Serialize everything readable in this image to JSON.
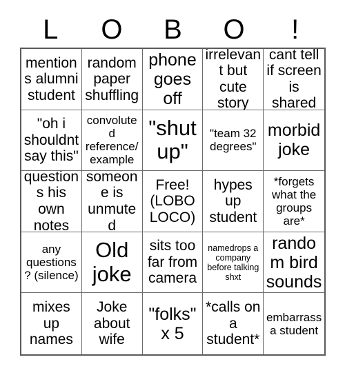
{
  "header": {
    "letters": [
      "L",
      "O",
      "B",
      "O",
      "!"
    ]
  },
  "grid": {
    "columns": 5,
    "rows": 5,
    "cells": [
      {
        "text": "mentions alumni student",
        "size": "md"
      },
      {
        "text": "random paper shuffling",
        "size": "md"
      },
      {
        "text": "phone goes off",
        "size": "lg"
      },
      {
        "text": "irrelevant but cute story",
        "size": "md"
      },
      {
        "text": "cant tell if screen is shared",
        "size": "md"
      },
      {
        "text": "\"oh i shouldnt say this\"",
        "size": "md"
      },
      {
        "text": "convoluted reference/ example",
        "size": "sm"
      },
      {
        "text": "\"shut up\"",
        "size": "xl"
      },
      {
        "text": "\"team 32 degrees\"",
        "size": "sm"
      },
      {
        "text": "morbid joke",
        "size": "lg"
      },
      {
        "text": "questions his own notes",
        "size": "md"
      },
      {
        "text": "someone is unmuted",
        "size": "md"
      },
      {
        "text": "Free! (LOBO LOCO)",
        "size": "md"
      },
      {
        "text": "hypes up student",
        "size": "md"
      },
      {
        "text": "*forgets what the groups are*",
        "size": "sm"
      },
      {
        "text": "any questions? (silence)",
        "size": "sm"
      },
      {
        "text": "Old joke",
        "size": "xl"
      },
      {
        "text": "sits too far from camera",
        "size": "md"
      },
      {
        "text": "namedrops a company before talking shxt",
        "size": "xxs"
      },
      {
        "text": "random bird sounds",
        "size": "lg"
      },
      {
        "text": "mixes up names",
        "size": "md"
      },
      {
        "text": "Joke about wife",
        "size": "md"
      },
      {
        "text": "\"folks\" x 5",
        "size": "lg"
      },
      {
        "text": "*calls on a student*",
        "size": "md"
      },
      {
        "text": "embarrass a student",
        "size": "sm"
      }
    ]
  }
}
